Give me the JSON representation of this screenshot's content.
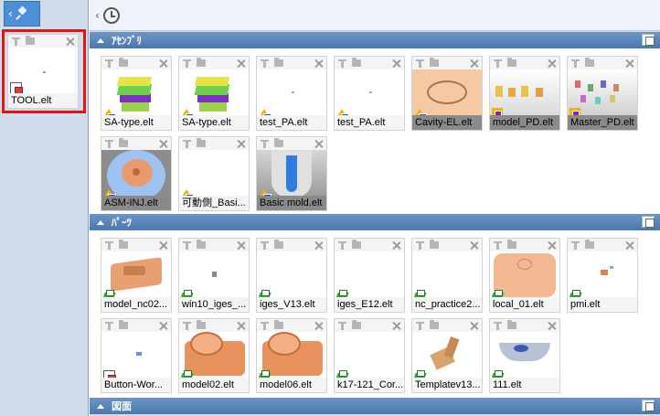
{
  "left_panel": {
    "card": {
      "name": "TOOL.elt",
      "type": "sheet"
    }
  },
  "sections": [
    {
      "title": "ｱｾﾝﾌﾞﾘ",
      "items": [
        {
          "name": "SA-type.elt",
          "type": "asm",
          "thumb": "mold-green"
        },
        {
          "name": "SA-type.elt",
          "type": "asm",
          "thumb": "mold-green"
        },
        {
          "name": "test_PA.elt",
          "type": "asm",
          "thumb": "dot"
        },
        {
          "name": "test_PA.elt",
          "type": "asm",
          "thumb": "dot"
        },
        {
          "name": "Cavity-EL.elt",
          "type": "asm",
          "thumb": "cavity"
        },
        {
          "name": "model_PD.elt",
          "type": "pd",
          "thumb": "figures"
        },
        {
          "name": "Master_PD.elt",
          "type": "pd",
          "thumb": "figures-many"
        },
        {
          "name": "ASM-INJ.elt",
          "type": "asm",
          "thumb": "disc"
        },
        {
          "name": "可動側_Basi...",
          "type": "asm",
          "thumb": "blank"
        },
        {
          "name": "Basic mold.elt",
          "type": "asm",
          "thumb": "basic-mold"
        }
      ]
    },
    {
      "title": "ﾊﾟｰﾂ",
      "items": [
        {
          "name": "model_nc02...",
          "type": "part",
          "thumb": "block"
        },
        {
          "name": "win10_iges_...",
          "type": "part",
          "thumb": "small-dot"
        },
        {
          "name": "iges_V13.elt",
          "type": "part",
          "thumb": "blank"
        },
        {
          "name": "iges_E12.elt",
          "type": "part",
          "thumb": "blank"
        },
        {
          "name": "nc_practice2...",
          "type": "part",
          "thumb": "blank"
        },
        {
          "name": "local_01.elt",
          "type": "part",
          "thumb": "local"
        },
        {
          "name": "pmi.elt",
          "type": "part",
          "thumb": "pmi"
        },
        {
          "name": "Button-Wor...",
          "type": "sheet",
          "thumb": "small-blue"
        },
        {
          "name": "model02.elt",
          "type": "part",
          "thumb": "ring"
        },
        {
          "name": "model06.elt",
          "type": "part",
          "thumb": "ring"
        },
        {
          "name": "k17-121_Cor...",
          "type": "part",
          "thumb": "blank"
        },
        {
          "name": "Templatev13...",
          "type": "part",
          "thumb": "bracket"
        },
        {
          "name": "111.elt",
          "type": "part",
          "thumb": "tray"
        }
      ]
    },
    {
      "title": "図面",
      "items": []
    }
  ]
}
